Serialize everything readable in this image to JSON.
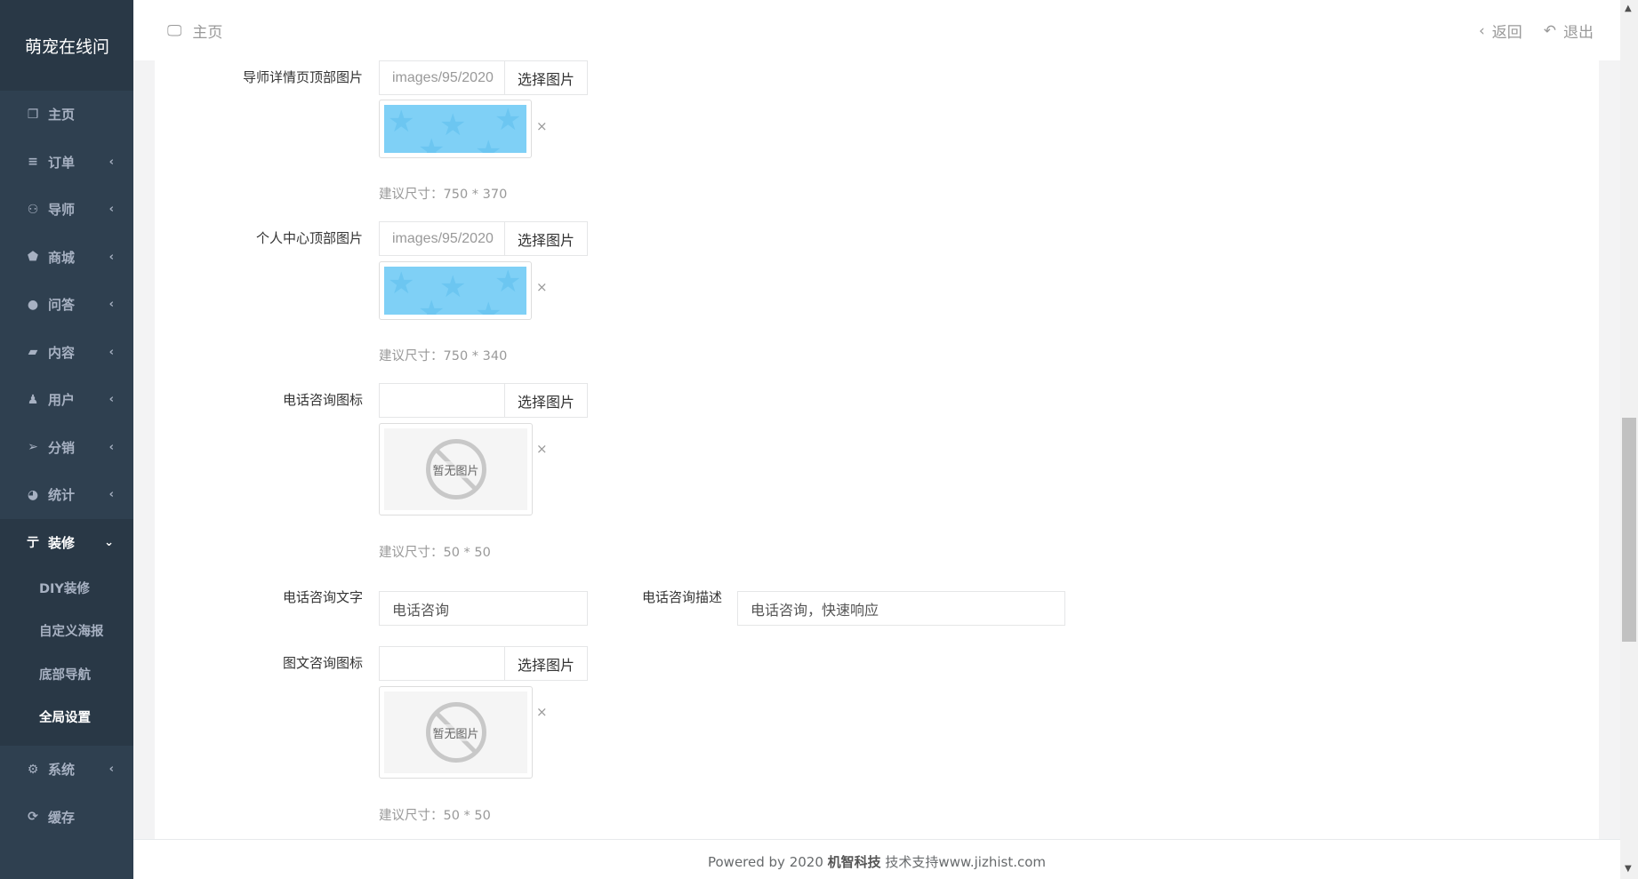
{
  "brand": "萌宠在线问",
  "sidebar": {
    "items": [
      {
        "label": "主页",
        "icon": "copy-icon",
        "glyph": "❐",
        "arrow": ""
      },
      {
        "label": "订单",
        "icon": "list-icon",
        "glyph": "≡",
        "arrow": "‹"
      },
      {
        "label": "导师",
        "icon": "user-outline-icon",
        "glyph": "⚇",
        "arrow": "‹"
      },
      {
        "label": "商城",
        "icon": "tags-icon",
        "glyph": "⬟",
        "arrow": "‹"
      },
      {
        "label": "问答",
        "icon": "comment-icon",
        "glyph": "●",
        "arrow": "‹"
      },
      {
        "label": "内容",
        "icon": "book-icon",
        "glyph": "▰",
        "arrow": "‹"
      },
      {
        "label": "用户",
        "icon": "user-icon",
        "glyph": "♟",
        "arrow": "‹"
      },
      {
        "label": "分销",
        "icon": "paper-plane-icon",
        "glyph": "➢",
        "arrow": "‹"
      },
      {
        "label": "统计",
        "icon": "pie-chart-icon",
        "glyph": "◕",
        "arrow": "‹"
      }
    ],
    "active": {
      "label": "装修",
      "icon": "decoration-icon",
      "glyph": "亍",
      "arrow": "⌄"
    },
    "sub": [
      "DIY装修",
      "自定义海报",
      "底部导航",
      "全局设置"
    ],
    "bottom": [
      {
        "label": "系统",
        "icon": "gear-icon",
        "glyph": "⚙",
        "arrow": "‹"
      },
      {
        "label": "缓存",
        "icon": "refresh-icon",
        "glyph": "⟳",
        "arrow": ""
      }
    ]
  },
  "topbar": {
    "home": "主页",
    "back": "返回",
    "logout": "退出"
  },
  "form": {
    "mentor_header": {
      "label": "导师详情页顶部图片",
      "value": "images/95/2020",
      "button": "选择图片",
      "hint": "建议尺寸：750 * 370"
    },
    "profile_header": {
      "label": "个人中心顶部图片",
      "value": "images/95/2020",
      "button": "选择图片",
      "hint": "建议尺寸：750 * 340"
    },
    "phone_icon": {
      "label": "电话咨询图标",
      "value": "",
      "button": "选择图片",
      "no_image": "暂无图片",
      "hint": "建议尺寸：50 * 50"
    },
    "phone_text": {
      "label": "电话咨询文字",
      "value": "电话咨询"
    },
    "phone_desc": {
      "label": "电话咨询描述",
      "value": "电话咨询，快速响应"
    },
    "chat_icon": {
      "label": "图文咨询图标",
      "value": "",
      "button": "选择图片",
      "no_image": "暂无图片",
      "hint": "建议尺寸：50 * 50"
    },
    "remove": "×"
  },
  "footer": {
    "prefix": "Powered by 2020 ",
    "company": "机智科技",
    "suffix": " 技术支持www.jizhist.com"
  }
}
